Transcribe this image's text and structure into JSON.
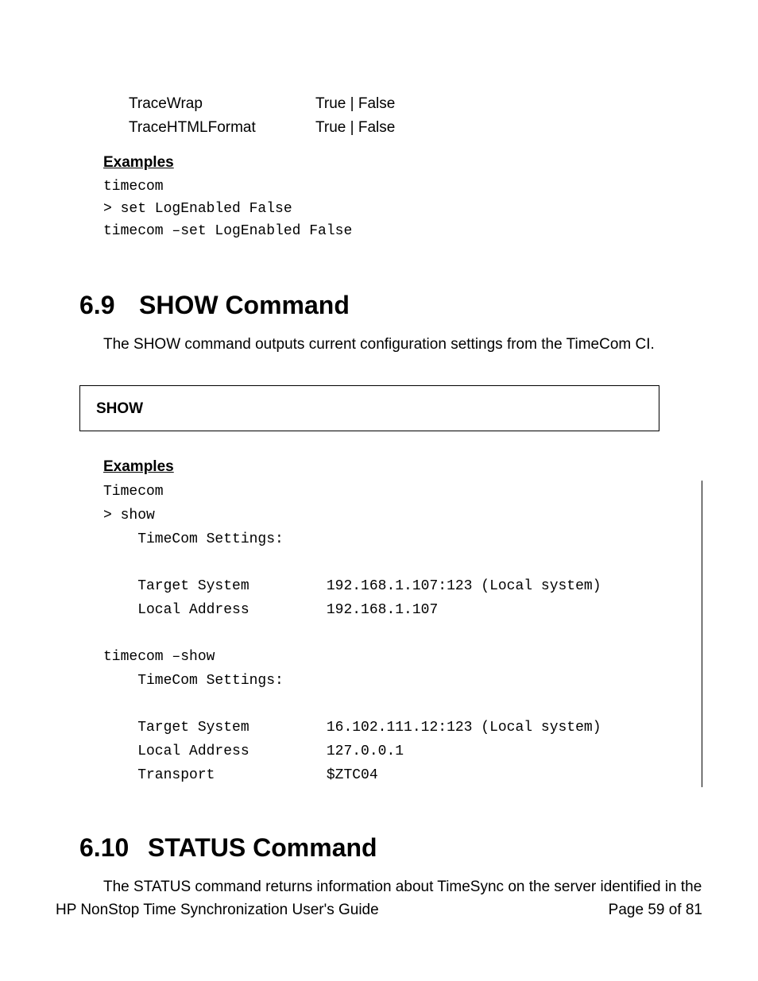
{
  "params": [
    {
      "name": "TraceWrap",
      "val": "True | False"
    },
    {
      "name": "TraceHTMLFormat",
      "val": "True | False"
    }
  ],
  "examples1": {
    "heading": "Examples",
    "code": "timecom\n> set LogEnabled False\ntimecom –set LogEnabled False"
  },
  "section69": {
    "num": "6.9",
    "title": "SHOW Command",
    "desc": "The SHOW command outputs current configuration settings from the TimeCom CI.",
    "syntax": "SHOW"
  },
  "examples2": {
    "heading": "Examples",
    "code": "Timecom\n> show\n    TimeCom Settings:\n\n    Target System         192.168.1.107:123 (Local system)\n    Local Address         192.168.1.107\n\ntimecom –show\n    TimeCom Settings:\n\n    Target System         16.102.111.12:123 (Local system)\n    Local Address         127.0.0.1\n    Transport             $ZTC04"
  },
  "section610": {
    "num": "6.10",
    "title": "STATUS Command",
    "desc": "The STATUS command returns information about TimeSync on the server identified in the"
  },
  "footer": {
    "left": "HP NonStop Time Synchronization User's Guide",
    "right": "Page 59 of 81"
  }
}
